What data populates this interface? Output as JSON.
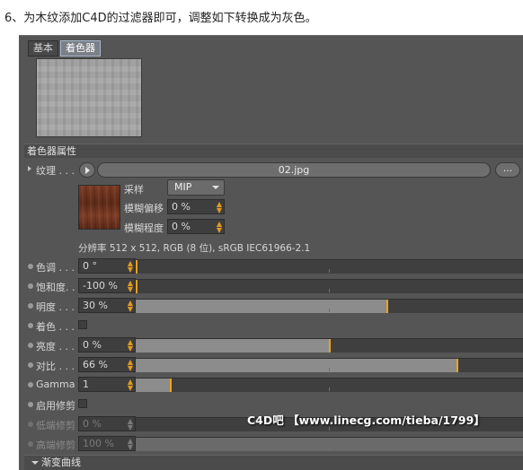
{
  "caption": "6、为木纹添加C4D的过滤器即可，调整如下转换成为灰色。",
  "tabs": [
    {
      "label": "基本",
      "active": false
    },
    {
      "label": "着色器",
      "active": true
    }
  ],
  "section_header": "着色器属性",
  "texture": {
    "label": "纹理 . . .",
    "file": "02.jpg",
    "more_label": "...",
    "sampling_label": "采样",
    "sampling_value": "MIP",
    "blur_offset_label": "模糊偏移",
    "blur_offset_value": "0 %",
    "blur_degree_label": "模糊程度",
    "blur_degree_value": "0 %",
    "info": "分辨率 512 x 512, RGB (8 位), sRGB IEC61966-2.1"
  },
  "params": [
    {
      "label": "色调 . . .",
      "value": "0 °",
      "fraction": 0.0,
      "type": "slider",
      "enabled": true
    },
    {
      "label": "饱和度. .",
      "value": "-100 %",
      "fraction": 0.0,
      "type": "slider",
      "enabled": true
    },
    {
      "label": "明度 . . .",
      "value": "30 %",
      "fraction": 0.65,
      "type": "slider",
      "enabled": true
    },
    {
      "label": "着色 . . .",
      "checked": false,
      "type": "checkbox",
      "enabled": true
    },
    {
      "label": "亮度 . . .",
      "value": "0 %",
      "fraction": 0.5,
      "type": "slider",
      "enabled": true
    },
    {
      "label": "对比 . . .",
      "value": "66 %",
      "fraction": 0.83,
      "type": "slider",
      "enabled": true
    },
    {
      "label": "Gamma",
      "value": "1",
      "fraction": 0.09,
      "type": "slider",
      "enabled": true
    },
    {
      "label": "启用修剪",
      "checked": false,
      "type": "checkbox",
      "enabled": true
    },
    {
      "label": "低端修剪",
      "value": "0 %",
      "fraction": 0.0,
      "type": "slider",
      "enabled": false
    },
    {
      "label": "高端修剪",
      "value": "100 %",
      "fraction": 1.0,
      "type": "slider",
      "enabled": false
    }
  ],
  "footer": "渐变曲线",
  "watermark": "C4D吧 【www.linecg.com/tieba/1799】",
  "colors": {
    "panel": "#555555",
    "handle": "#f0a21a",
    "fill": "#8c8c8c"
  }
}
